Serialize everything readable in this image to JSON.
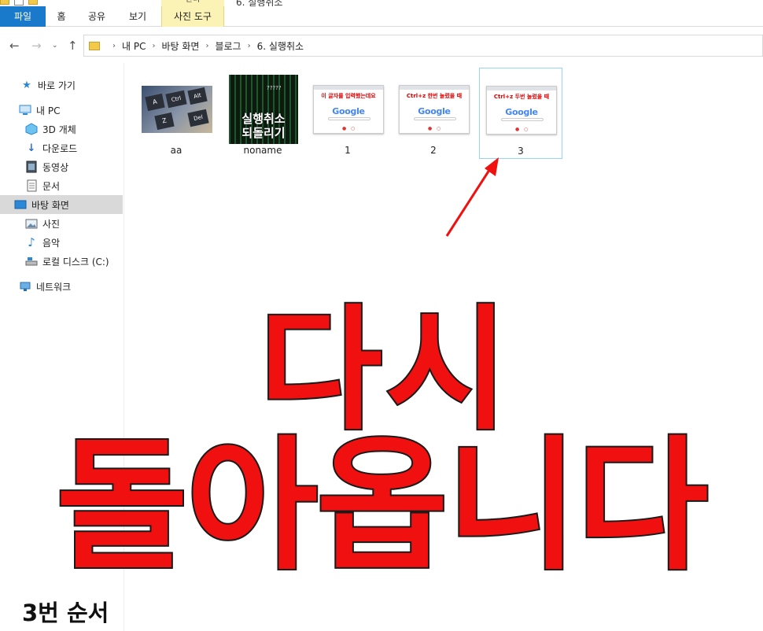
{
  "window": {
    "title": "6. 실행취소",
    "context_group": "관리"
  },
  "ribbon": {
    "tabs": [
      {
        "label": "파일"
      },
      {
        "label": "홈"
      },
      {
        "label": "공유"
      },
      {
        "label": "보기"
      },
      {
        "label": "사진 도구"
      }
    ]
  },
  "address": {
    "breadcrumbs": [
      "내 PC",
      "바탕 화면",
      "블로그",
      "6. 실행취소"
    ]
  },
  "sidebar": {
    "items": [
      {
        "label": "바로 가기",
        "icon": "star-icon"
      },
      {
        "label": "내 PC",
        "icon": "pc-icon"
      },
      {
        "label": "3D 개체",
        "icon": "cube-icon"
      },
      {
        "label": "다운로드",
        "icon": "download-icon"
      },
      {
        "label": "동영상",
        "icon": "video-icon"
      },
      {
        "label": "문서",
        "icon": "document-icon"
      },
      {
        "label": "바탕 화면",
        "icon": "desktop-icon"
      },
      {
        "label": "사진",
        "icon": "picture-icon"
      },
      {
        "label": "음악",
        "icon": "music-icon"
      },
      {
        "label": "로컬 디스크 (C:)",
        "icon": "disk-icon"
      },
      {
        "label": "네트워크",
        "icon": "network-icon"
      }
    ],
    "selected": "바탕 화면"
  },
  "files": [
    {
      "name": "aa",
      "thumb_keys": [
        "A",
        "Ctrl",
        "Alt",
        "Z",
        "Del"
      ]
    },
    {
      "name": "noname",
      "thumb_text": [
        "실행취소",
        "되돌리기"
      ],
      "thumb_marks": "?????"
    },
    {
      "name": "1",
      "note": "이 글자를 입력했는데요",
      "logo": "Google"
    },
    {
      "name": "2",
      "note": "Ctrl+z 한번 눌렀을 때",
      "logo": "Google"
    },
    {
      "name": "3",
      "note": "Ctrl+z 두번 눌렀을 때",
      "logo": "Google"
    }
  ],
  "overlay": {
    "line1": "다시",
    "line2": "돌아옵니다",
    "caption": "3번 순서",
    "color": "#f01010"
  }
}
